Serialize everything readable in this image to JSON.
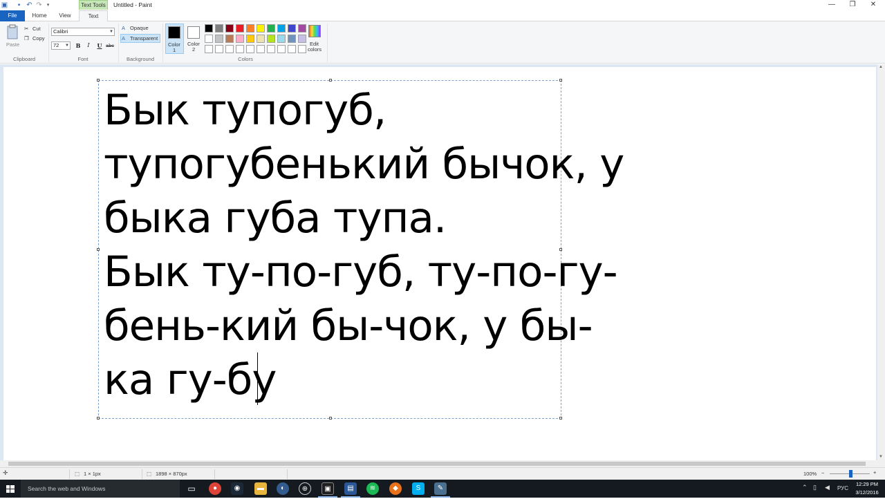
{
  "window": {
    "title": "Untitled - Paint",
    "contextual_tab_group": "Text Tools",
    "minimize_glyph": "—",
    "maximize_glyph": "❐",
    "close_glyph": "✕"
  },
  "tabs": [
    {
      "label": "File"
    },
    {
      "label": "Home"
    },
    {
      "label": "View"
    },
    {
      "label": "Text"
    }
  ],
  "ribbon": {
    "clipboard": {
      "label": "Clipboard",
      "paste": "Paste",
      "cut": "Cut",
      "copy": "Copy"
    },
    "font": {
      "label": "Font",
      "family": "Calibri",
      "size": "72",
      "bold": "B",
      "italic": "I",
      "underline": "U",
      "strikethrough": "abc"
    },
    "background": {
      "label": "Background",
      "opaque": "Opaque",
      "transparent": "Transparent"
    },
    "colors": {
      "label": "Colors",
      "color1_label": "Color",
      "color1_num": "1",
      "color2_label": "Color",
      "color2_num": "2",
      "edit_colors_1": "Edit",
      "edit_colors_2": "colors",
      "color1_value": "#000000",
      "color2_value": "#ffffff",
      "palette_row1": [
        "#000000",
        "#7f7f7f",
        "#880015",
        "#ed1c24",
        "#ff7f27",
        "#fff200",
        "#22b14c",
        "#00a2e8",
        "#3f48cc",
        "#a349a4"
      ],
      "palette_row2": [
        "#ffffff",
        "#c3c3c3",
        "#b97a57",
        "#ffaec9",
        "#ffc90e",
        "#efe4b0",
        "#b5e61d",
        "#99d9ea",
        "#7092be",
        "#c8bfe7"
      ],
      "palette_row3": [
        "#ffffff",
        "#ffffff",
        "#ffffff",
        "#ffffff",
        "#ffffff",
        "#ffffff",
        "#ffffff",
        "#ffffff",
        "#ffffff",
        "#ffffff"
      ]
    }
  },
  "canvas": {
    "text_lines": [
      "Бык тупогуб,",
      "тупогубенький бычок, у",
      "быка губа тупа.",
      "Бык ту-по-губ, ту-по-гу-",
      "бень-кий бы-чок, у бы-",
      "ка гу-бу"
    ]
  },
  "statusbar": {
    "selection_size": "1 × 1px",
    "canvas_size": "1898 × 870px",
    "zoom": "100%"
  },
  "taskbar": {
    "search_placeholder": "Search the web and Windows",
    "language": "РУС",
    "time": "12:29 PM",
    "date": "3/12/2016"
  }
}
